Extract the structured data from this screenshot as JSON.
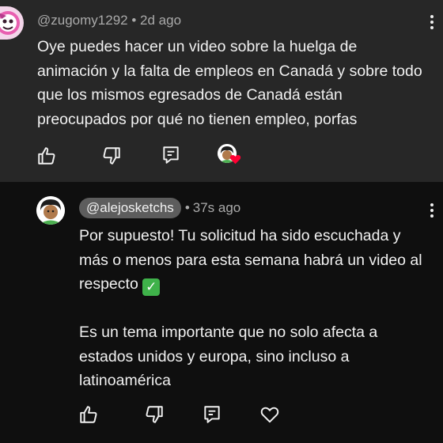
{
  "top_comment": {
    "username": "@zugomy1292",
    "separator": "•",
    "time": "2d ago",
    "text": "Oye puedes hacer un video sobre la huelga de animación y la falta de empleos en Canadá y sobre todo que los mismos egresados de Canadá están preocupados por qué no tienen empleo, porfas",
    "actions": [
      "like-icon",
      "dislike-icon",
      "reply-icon",
      "creator-heart-icon"
    ]
  },
  "reply": {
    "username": "@alejosketchs",
    "separator": "•",
    "time": "37s ago",
    "paragraph_1": "Por supuesto! Tu solicitud ha sido escuchada y más o menos para esta semana habrá un video al respecto",
    "check_emoji": "✓",
    "paragraph_2": "Es un tema importante que no solo afecta a estados unidos y europa, sino incluso a latinoamérica",
    "actions": [
      "like-icon",
      "dislike-icon",
      "reply-icon",
      "heart-icon"
    ]
  },
  "colors": {
    "top_background": "#272727",
    "page_background": "#0f0f0f",
    "text_primary": "#f1f1f1",
    "text_secondary": "#aaaaaa",
    "handle_pill": "#5d5d5d",
    "heart_red": "#ff0033",
    "check_green": "#3fb24a"
  }
}
